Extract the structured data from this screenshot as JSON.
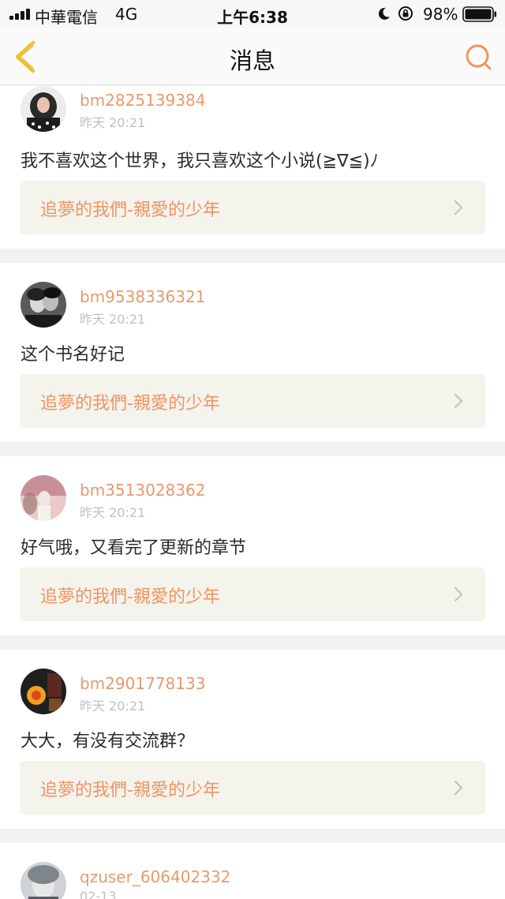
{
  "status_bar": {
    "carrier": "中華電信",
    "network": "4G",
    "time": "上午6:38",
    "battery": "98%"
  },
  "nav": {
    "title": "消息"
  },
  "messages": [
    {
      "username": "bm2825139384",
      "time": "昨天 20:21",
      "text": "我不喜欢这个世界，我只喜欢这个小说(≧∇≦)ﾉ",
      "book": "追夢的我們-親愛的少年"
    },
    {
      "username": "bm9538336321",
      "time": "昨天 20:21",
      "text": "这个书名好记",
      "book": "追夢的我們-親愛的少年"
    },
    {
      "username": "bm3513028362",
      "time": "昨天 20:21",
      "text": "好气哦，又看完了更新的章节",
      "book": "追夢的我們-親愛的少年"
    },
    {
      "username": "bm2901778133",
      "time": "昨天 20:21",
      "text": "大大，有没有交流群？",
      "book": "追夢的我們-親愛的少年"
    },
    {
      "username": "qzuser_606402332",
      "time": "02-13",
      "text": "",
      "book": ""
    }
  ],
  "colors": {
    "accent": "#ef9462",
    "username": "#e69a6c",
    "back_arrow": "#f0c22a",
    "card_link_bg": "#f4f3ec",
    "page_bg": "#f2f2f2"
  },
  "icons": {
    "back": "back-chevron-icon",
    "search": "search-icon",
    "row_arrow": "chevron-right-icon"
  }
}
